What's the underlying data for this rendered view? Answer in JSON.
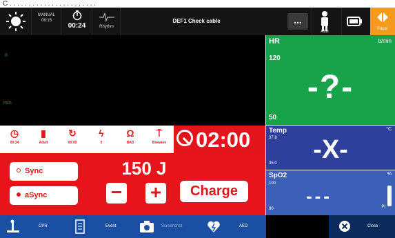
{
  "top_cut_text": "C . . . . . . . . . . . . . . . . . . . . . . .",
  "statusbar": {
    "brightness_icon": "sun-icon",
    "info_small_1": "MANUAL",
    "info_small_2": "06:15",
    "timer": "00:24",
    "rhythm_label": "Rhythm",
    "title": "DEF1 Check cable",
    "more_label": "...",
    "adult_label": "Adult",
    "pacer_label": "Pacer"
  },
  "waveform": {
    "lead_label_1": "II",
    "lead_label_2": "mm"
  },
  "hr": {
    "name": "HR",
    "unit": "b/min",
    "high": "120",
    "low": "50",
    "value": "-?-"
  },
  "temp": {
    "name": "Temp",
    "unit": "°C",
    "high": "37.8",
    "low": "35.0",
    "value": "-X-"
  },
  "spo2": {
    "name": "SpO2",
    "unit": "%",
    "high": "100",
    "low": "90",
    "value": "---",
    "pi_label": "PI"
  },
  "settings": [
    {
      "icon": "stopwatch-icon",
      "label": "00:24"
    },
    {
      "icon": "pad-icon",
      "label": "Adult"
    },
    {
      "icon": "timer-icon",
      "label": "00:00"
    },
    {
      "icon": "shock-icon",
      "label": "0"
    },
    {
      "icon": "ohm-icon",
      "label": "BAD"
    },
    {
      "icon": "biphasic-icon",
      "label": "Biowave"
    }
  ],
  "timer": {
    "value": "02:00"
  },
  "defib": {
    "sync_label": "Sync",
    "async_label": "aSync",
    "energy": "150 J",
    "minus": "−",
    "plus": "+",
    "charge_label": "Charge"
  },
  "bottombar": {
    "cpr_label": "CPR",
    "event_label": "Event",
    "screenshot_label": "Screenshot",
    "aed_label": "AED",
    "close_label": "Close"
  },
  "colors": {
    "red": "#e3141b",
    "green": "#18a34a",
    "blue": "#1a4fa3",
    "temp_blue": "#2e3f9c",
    "spo2_blue": "#3c5fb8"
  }
}
